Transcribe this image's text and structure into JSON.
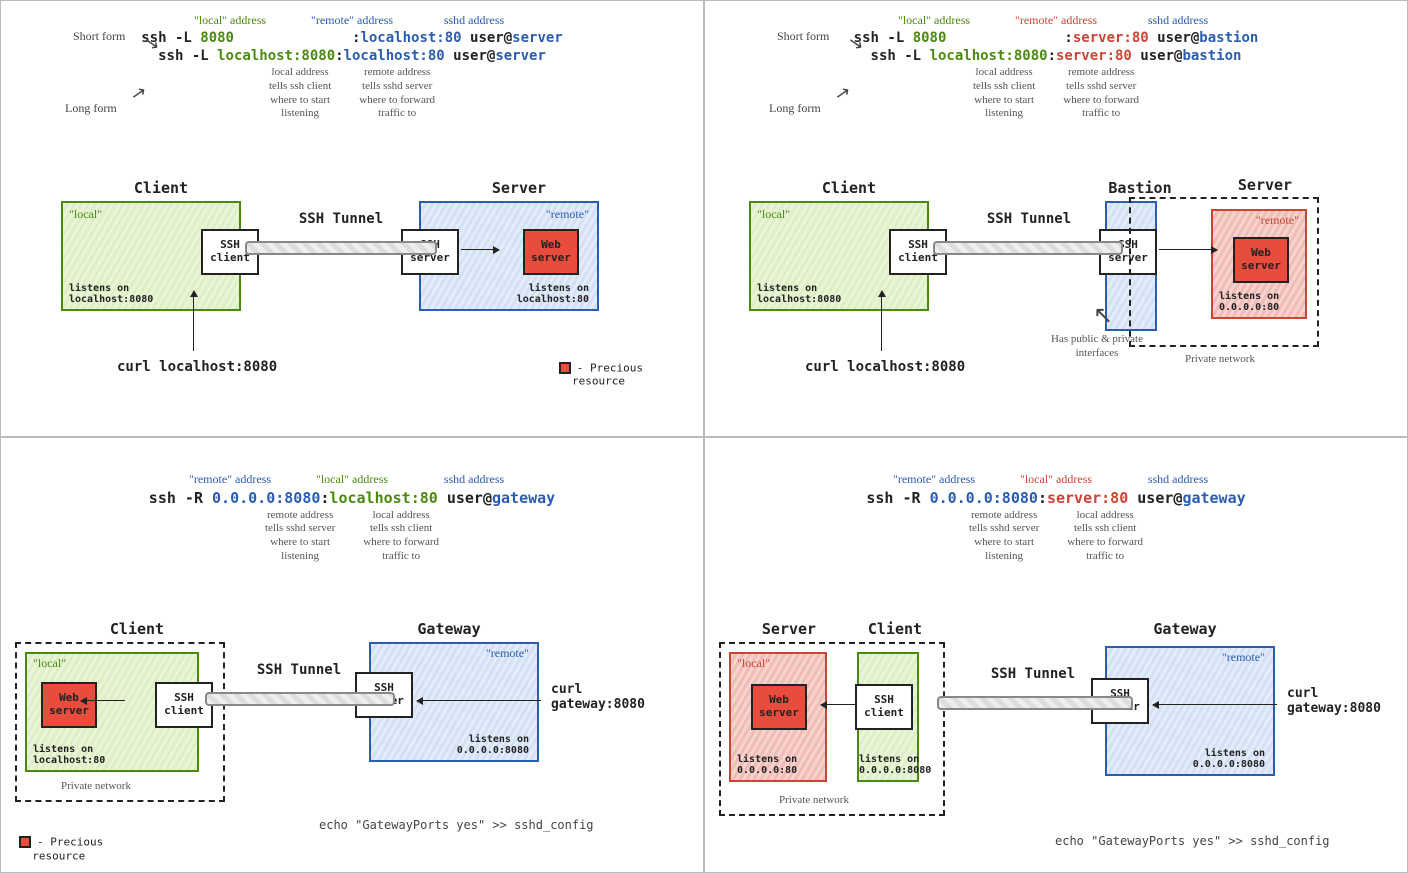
{
  "common": {
    "tunnel": "SSH Tunnel",
    "ssh_client": "SSH\nclient",
    "ssh_server": "SSH\nserver",
    "web_server": "Web\nserver",
    "local_tag": "\"local\"",
    "remote_tag": "\"remote\"",
    "precious": "- Precious\n  resource",
    "privnet": "Private network",
    "bastion_label": "Bastion",
    "server_label": "Server",
    "client_label": "Client",
    "gateway_label": "Gateway",
    "short_form": "Short form",
    "long_form": "Long form",
    "has_pub_priv": "Has public & private\ninterfaces",
    "echo": "echo \"GatewayPorts yes\" >> sshd_config",
    "hint_local_addr": "\"local\" address",
    "hint_remote_addr": "\"remote\" address",
    "hint_sshd_addr": "sshd address",
    "hint_local_listen": "local address\ntells ssh client\nwhere to start\nlistening",
    "hint_remote_fwd": "remote address\ntells sshd server\nwhere to forward\ntraffic to",
    "hint_remote_listen": "remote address\ntells sshd server\nwhere to start\nlistening",
    "hint_local_fwd": "local address\ntells ssh client\nwhere to forward\ntraffic to"
  },
  "q1": {
    "cmd1_pre": "ssh -L ",
    "cmd1_local": "8080",
    "cmd1_gap": "              ",
    "cmd1_colon": ":",
    "cmd1_remote": "localhost:80",
    "cmd1_user": " user@",
    "cmd1_host": "server",
    "cmd2_local": "localhost:8080",
    "listens_local": "listens on\nlocalhost:8080",
    "listens_remote": "listens on\nlocalhost:80",
    "curl": "curl localhost:8080"
  },
  "q2": {
    "cmd1_pre": "ssh -L ",
    "cmd1_local": "8080",
    "cmd1_gap": "              ",
    "cmd1_colon": ":",
    "cmd1_remote": "server:80",
    "cmd1_user": " user@",
    "cmd1_host": "bastion",
    "cmd2_local": "localhost:8080",
    "listens_local": "listens on\nlocalhost:8080",
    "listens_remote": "listens on\n0.0.0.0:80",
    "curl": "curl localhost:8080"
  },
  "q3": {
    "cmd_pre": "ssh -R ",
    "cmd_remote": "0.0.0.0:8080",
    "cmd_colon": ":",
    "cmd_local": "localhost:80",
    "cmd_user": " user@",
    "cmd_host": "gateway",
    "listens_local": "listens on\nlocalhost:80",
    "listens_remote": "listens on\n0.0.0.0:8080",
    "curl": "curl\ngateway:8080"
  },
  "q4": {
    "cmd_pre": "ssh -R ",
    "cmd_remote": "0.0.0.0:8080",
    "cmd_colon": ":",
    "cmd_local": "server:80",
    "cmd_user": " user@",
    "cmd_host": "gateway",
    "listens_local": "listens on\n0.0.0.0:80",
    "listens_remote": "listens on\n0.0.0.0:8080",
    "curl": "curl\ngateway:8080"
  }
}
